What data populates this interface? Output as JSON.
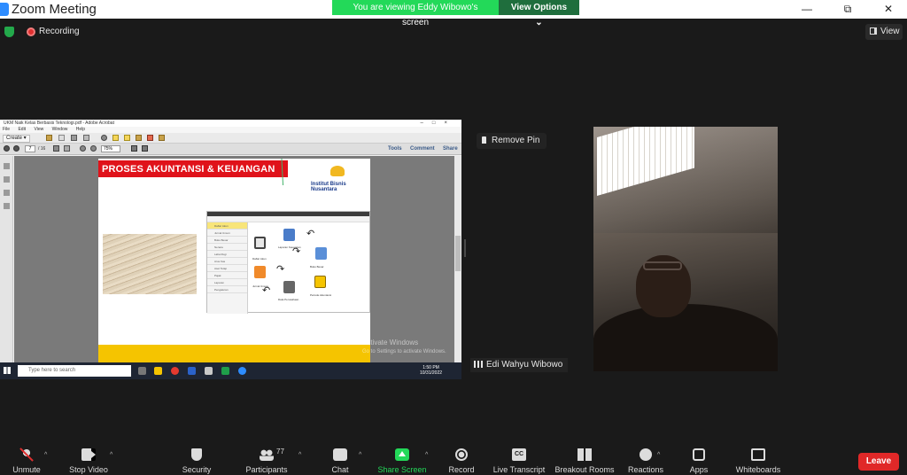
{
  "window": {
    "title": "Zoom Meeting",
    "share_banner": "You are viewing Eddy Wibowo's screen",
    "view_options": "View Options ⌄",
    "controls": [
      "—",
      "⧉",
      "✕"
    ]
  },
  "meeting": {
    "recording_label": "Recording",
    "view_label": "View",
    "remove_pin_label": "Remove Pin"
  },
  "shared_screen": {
    "acrobat_title": "UKM Naik Kelas Berbasis Teknologi.pdf - Adobe Acrobat",
    "menu": [
      "File",
      "Edit",
      "View",
      "Window",
      "Help"
    ],
    "create_label": "Create ▾",
    "page_number": "7",
    "page_count": "/ 16",
    "zoom": "75%",
    "right_tabs": [
      "Tools",
      "Comment",
      "Share"
    ],
    "slide": {
      "title": "PROSES AKUNTANSI & KEUANGAN",
      "institution": "Institut Bisnis Nusantara",
      "nav_items": [
        "Daftar Akun",
        "Jurnal Umum",
        "Buku Besar",
        "Neraca",
        "Laba Rugi",
        "Arus Kas",
        "Aset Tetap",
        "Pajak",
        "Laporan",
        "Pengaturan"
      ],
      "flow_labels": [
        "Daftar Akun",
        "Laporan Keuangan",
        "Buku Besar",
        "Jurnal Umum",
        "Data Perusahaan",
        "Periode Akuntansi"
      ]
    },
    "activate_windows": "Activate Windows",
    "activate_hint": "Go to Settings to activate Windows.",
    "taskbar_search": "Type here to search",
    "clock_time": "1:50 PM",
    "clock_date": "10/31/2022"
  },
  "participant": {
    "name": "Edi Wahyu Wibowo"
  },
  "toolbar": {
    "unmute": "Unmute",
    "stop_video": "Stop Video",
    "security": "Security",
    "participants": "Participants",
    "participants_count": "77",
    "chat": "Chat",
    "share_screen": "Share Screen",
    "record": "Record",
    "live_transcript": "Live Transcript",
    "breakout_rooms": "Breakout Rooms",
    "reactions": "Reactions",
    "apps": "Apps",
    "whiteboards": "Whiteboards",
    "leave": "Leave"
  },
  "colors": {
    "share_green": "#23d959",
    "leave_red": "#e02828",
    "slide_red": "#e0121a",
    "slide_yellow": "#f5c400"
  }
}
